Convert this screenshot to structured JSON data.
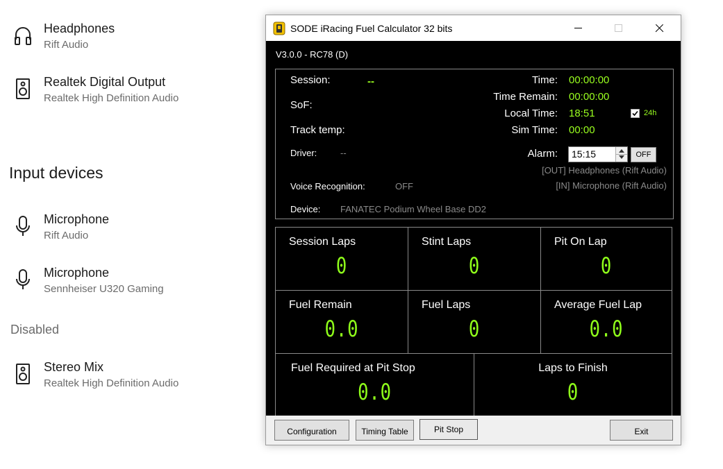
{
  "settings": {
    "output_devices": [
      {
        "name": "Headphones",
        "sub": "Rift Audio",
        "icon": "headphones-icon"
      },
      {
        "name": "Realtek Digital Output",
        "sub": "Realtek High Definition Audio",
        "icon": "speaker-icon"
      }
    ],
    "input_heading": "Input devices",
    "input_devices": [
      {
        "name": "Microphone",
        "sub": "Rift Audio",
        "icon": "microphone-icon"
      },
      {
        "name": "Microphone",
        "sub": "Sennheiser U320 Gaming",
        "icon": "microphone-icon"
      }
    ],
    "disabled_heading": "Disabled",
    "disabled_devices": [
      {
        "name": "Stereo Mix",
        "sub": "Realtek High Definition Audio",
        "icon": "speaker-icon"
      }
    ]
  },
  "window": {
    "title": "SODE iRacing Fuel Calculator 32 bits",
    "version": "V3.0.0 - RC78 (D)"
  },
  "info": {
    "session_label": "Session:",
    "session_value": "--",
    "sof_label": "SoF:",
    "track_temp_label": "Track temp:",
    "driver_label": "Driver:",
    "driver_value": "--",
    "voice_label": "Voice Recognition:",
    "voice_value": "OFF",
    "device_label": "Device:",
    "device_value": "FANATEC Podium Wheel Base DD2",
    "time_label": "Time:",
    "time_value": "00:00:00",
    "time_remain_label": "Time Remain:",
    "time_remain_value": "00:00:00",
    "local_time_label": "Local Time:",
    "local_time_value": "18:51",
    "format_24h_label": "24h",
    "format_24h_checked": true,
    "sim_time_label": "Sim Time:",
    "sim_time_value": "00:00",
    "alarm_label": "Alarm:",
    "alarm_value": "15:15",
    "alarm_toggle": "OFF",
    "out_device": "[OUT] Headphones (Rift Audio)",
    "in_device": "[IN] Microphone (Rift Audio)"
  },
  "stats": {
    "session_laps_label": "Session Laps",
    "session_laps": "0",
    "stint_laps_label": "Stint Laps",
    "stint_laps": "0",
    "pit_on_lap_label": "Pit On Lap",
    "pit_on_lap": "0",
    "fuel_remain_label": "Fuel Remain",
    "fuel_remain": "0.0",
    "fuel_laps_label": "Fuel Laps",
    "fuel_laps": "0",
    "avg_fuel_lap_label": "Average Fuel Lap",
    "avg_fuel_lap": "0.0",
    "fuel_required_label": "Fuel Required at Pit Stop",
    "fuel_required": "0.0",
    "laps_to_finish_label": "Laps to Finish",
    "laps_to_finish": "0"
  },
  "buttons": {
    "configuration": "Configuration",
    "timing_table": "Timing Table",
    "pit_stop": "Pit Stop",
    "exit": "Exit"
  },
  "colors": {
    "accent_green": "#9aff1f",
    "client_bg": "#000000"
  }
}
